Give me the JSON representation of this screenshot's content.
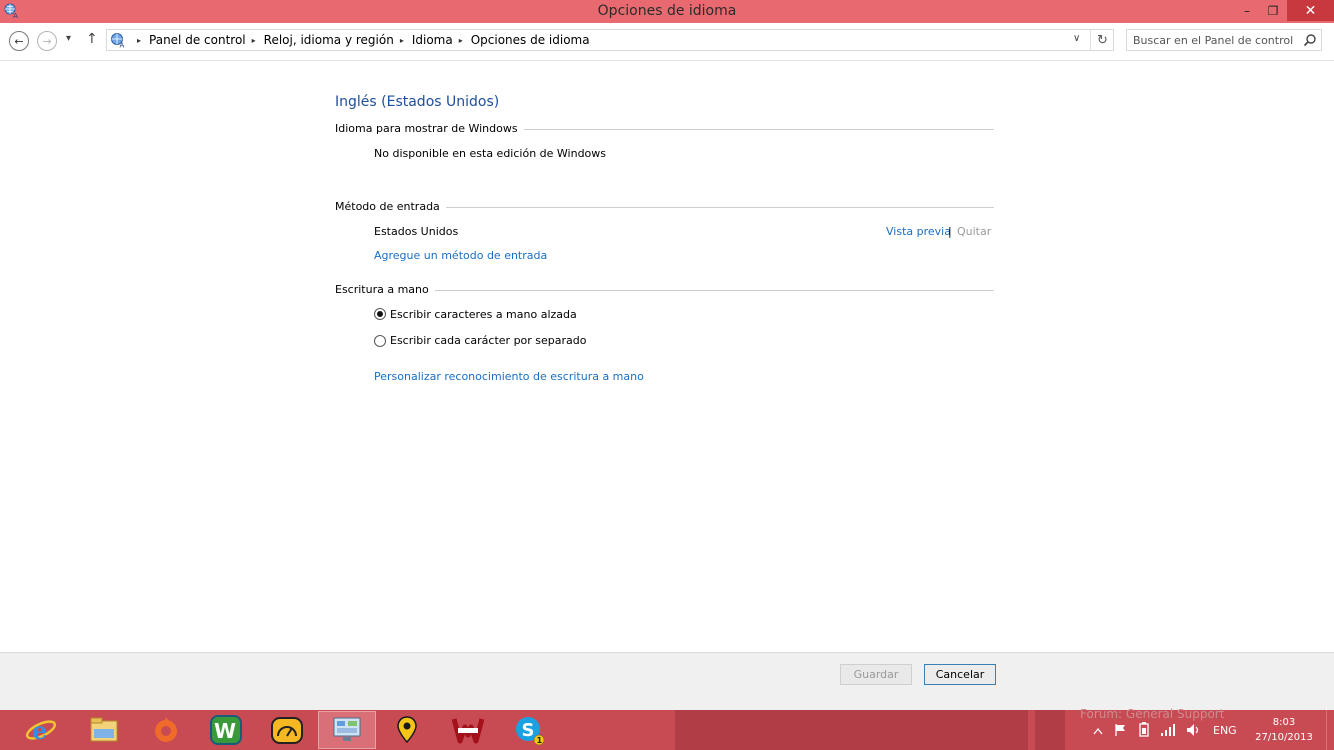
{
  "window": {
    "title": "Opciones de idioma",
    "controls": {
      "minimize": "–",
      "maximize": "❐",
      "close": "✕"
    }
  },
  "nav": {
    "back": "←",
    "forward": "→",
    "recent": "▾",
    "up": "↑",
    "breadcrumb": [
      "Panel de control",
      "Reloj, idioma y región",
      "Idioma",
      "Opciones de idioma"
    ],
    "separator": "▸",
    "dropdown": "∨",
    "refresh": "↻",
    "search_placeholder": "Buscar en el Panel de control"
  },
  "main": {
    "heading": "Inglés (Estados Unidos)",
    "display_language": {
      "title": "Idioma para mostrar de Windows",
      "value": "No disponible en esta edición de Windows"
    },
    "input_method": {
      "title": "Método de entrada",
      "item": "Estados Unidos",
      "preview_link": "Vista previa",
      "divider": "|",
      "remove_label": "Quitar",
      "add_link": "Agregue un método de entrada"
    },
    "handwriting": {
      "title": "Escritura a mano",
      "options": [
        {
          "label": "Escribir caracteres a mano alzada",
          "checked": true
        },
        {
          "label": "Escribir cada carácter por separado",
          "checked": false
        }
      ],
      "personalize_link": "Personalizar reconocimiento de escritura a mano"
    }
  },
  "footer": {
    "save": "Guardar",
    "cancel": "Cancelar"
  },
  "taskbar": {
    "apps": [
      "internet-explorer-icon",
      "file-explorer-icon",
      "origin-icon",
      "word-w-icon",
      "speedometer-icon",
      "control-panel-icon",
      "location-pin-icon",
      "wwe-icon",
      "skype-icon"
    ],
    "skype_badge": "1",
    "tray": {
      "ghost_text": "Forum: General Support",
      "language": "ENG",
      "time": "8:03",
      "date": "27/10/2013"
    }
  },
  "colors": {
    "titlebar": "#e8696f",
    "close_button": "#c7383f",
    "taskbar": "#c84a53",
    "link": "#1a6fc4",
    "heading": "#1f4e9c"
  }
}
